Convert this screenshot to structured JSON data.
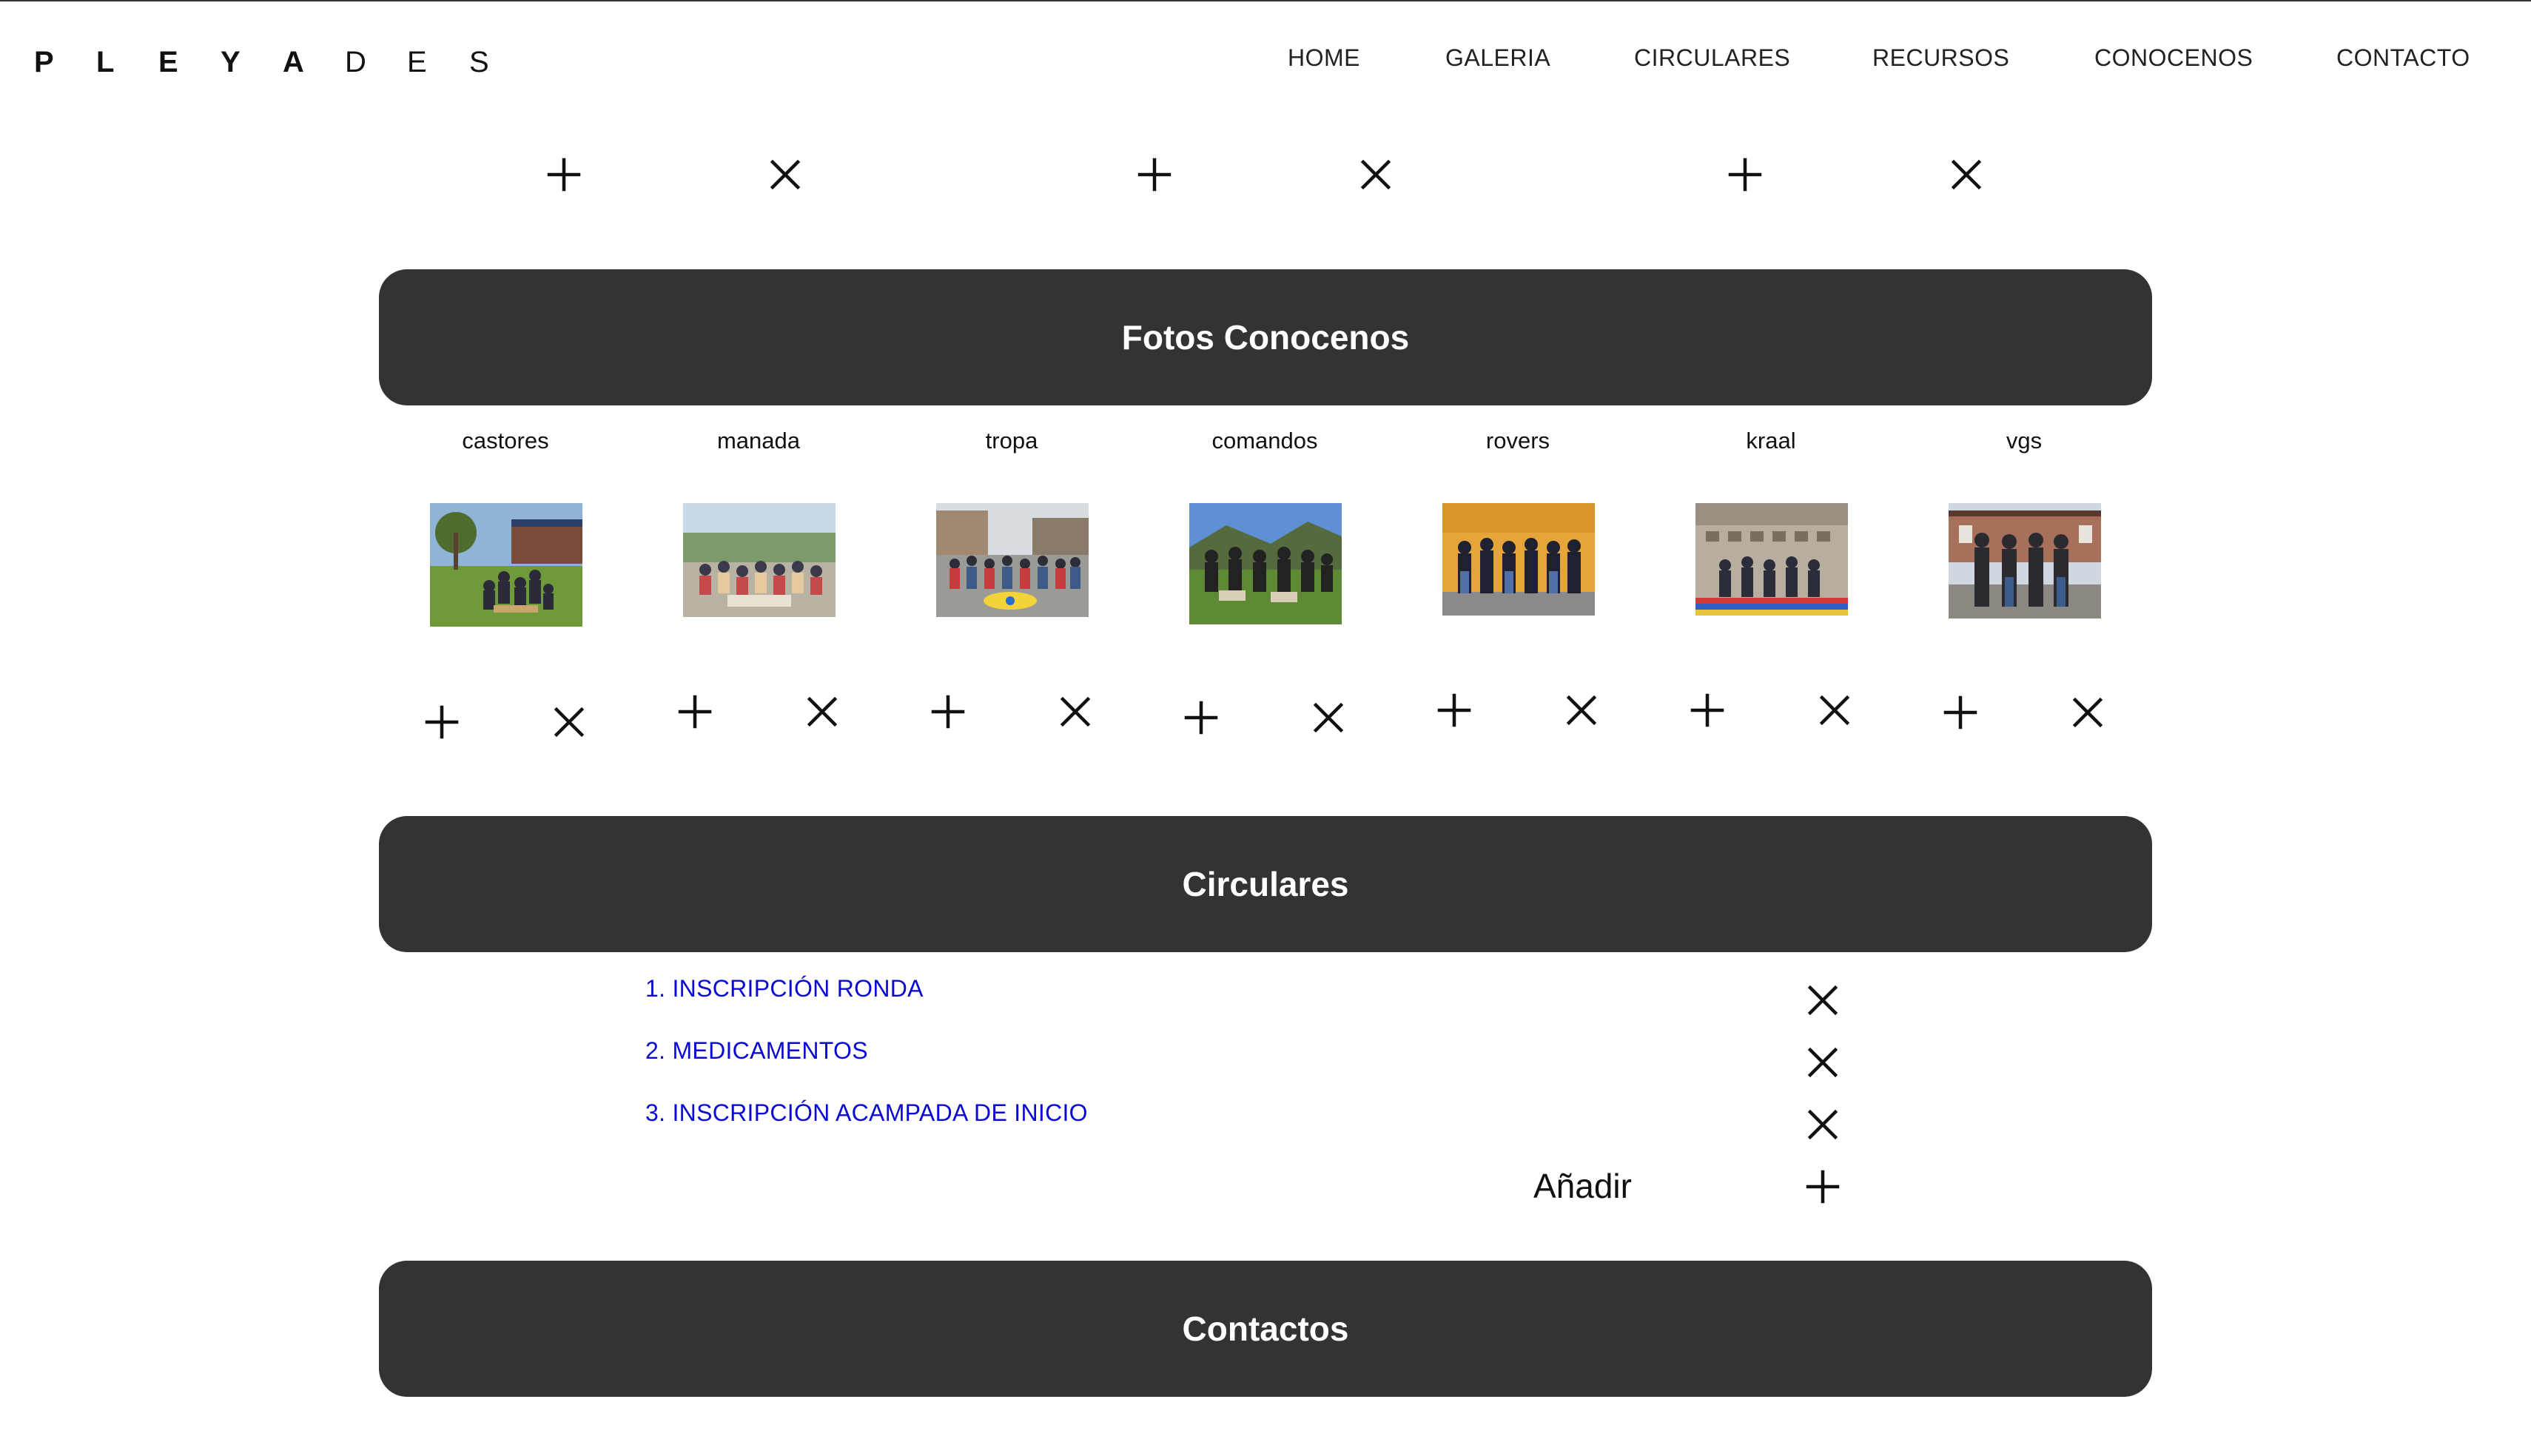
{
  "brand": {
    "letters": [
      "P",
      "L",
      "E",
      "Y",
      "A",
      "D",
      "E",
      "S"
    ]
  },
  "nav": {
    "home": "HOME",
    "galeria": "GALERIA",
    "circulares": "CIRCULARES",
    "recursos": "RECURSOS",
    "conocenos": "CONOCENOS",
    "contacto": "CONTACTO"
  },
  "sections": {
    "fotos": "Fotos Conocenos",
    "circulares": "Circulares",
    "contactos": "Contactos"
  },
  "groups": [
    {
      "label": "castores"
    },
    {
      "label": "manada"
    },
    {
      "label": "tropa"
    },
    {
      "label": "comandos"
    },
    {
      "label": "rovers"
    },
    {
      "label": "kraal"
    },
    {
      "label": "vgs"
    }
  ],
  "circulars": [
    {
      "label": "1. INSCRIPCIÓN RONDA"
    },
    {
      "label": "2. MEDICAMENTOS"
    },
    {
      "label": "3. INSCRIPCIÓN ACAMPADA DE INICIO"
    }
  ],
  "add_label": "Añadir",
  "icons": {
    "add": "plus-icon",
    "remove": "close-icon"
  },
  "colors": {
    "bar": "#333333",
    "link": "#0a0ad2",
    "background": "#ffffff"
  }
}
